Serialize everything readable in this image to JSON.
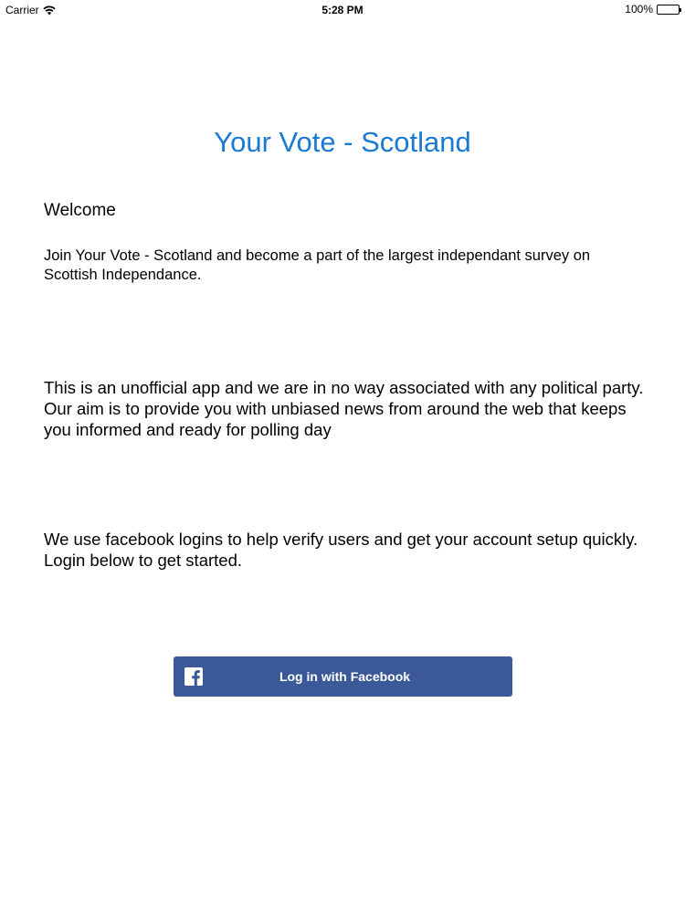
{
  "status_bar": {
    "carrier": "Carrier",
    "time": "5:28 PM",
    "battery": "100%"
  },
  "icons": {
    "wifi": "wifi-icon",
    "battery": "battery-icon",
    "facebook": "facebook-logo-icon"
  },
  "main": {
    "title": "Your Vote - Scotland",
    "welcome": "Welcome",
    "paragraph_join": "Join Your Vote - Scotland and become a part of the largest independant survey on Scottish Independance.",
    "paragraph_unofficial": "This is an unofficial app and we are in no way associated with any political party. Our aim is to provide you with unbiased news from around the web that keeps you informed and ready for polling day",
    "paragraph_facebook": "We use facebook logins to help verify users and get your account setup quickly. Login below to get started.",
    "login_button_label": "Log in with Facebook"
  },
  "colors": {
    "title": "#1a7ad3",
    "facebook_button": "#3b5998",
    "facebook_text": "#ffffff"
  }
}
